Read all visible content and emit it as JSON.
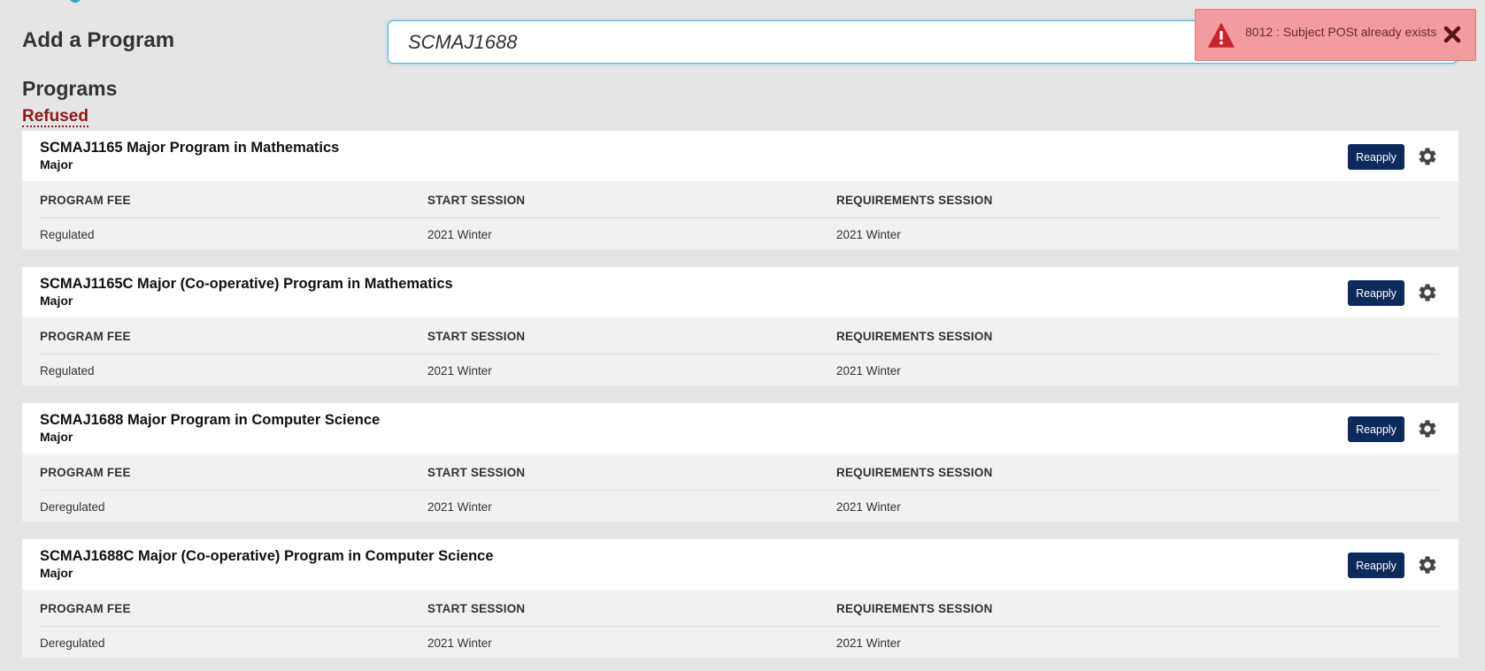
{
  "page": {
    "add_program_title": "Add a Program",
    "search": {
      "value": "SCMAJ1688",
      "placeholder": ""
    },
    "programs_heading": "Programs",
    "status_group": "Refused"
  },
  "toast": {
    "type": "error",
    "message": "8012 : Subject POSt already exists",
    "icons": [
      "warning-icon",
      "close-icon"
    ]
  },
  "columns": {
    "fee": "PROGRAM FEE",
    "start": "START SESSION",
    "requirements": "REQUIREMENTS SESSION"
  },
  "programs": [
    {
      "title": "SCMAJ1165 Major Program in Mathematics",
      "type": "Major",
      "action_label": "Reapply",
      "fee": "Regulated",
      "start_session": "2021 Winter",
      "requirements_session": "2021 Winter"
    },
    {
      "title": "SCMAJ1165C Major (Co-operative) Program in Mathematics",
      "type": "Major",
      "action_label": "Reapply",
      "fee": "Regulated",
      "start_session": "2021 Winter",
      "requirements_session": "2021 Winter"
    },
    {
      "title": "SCMAJ1688 Major Program in Computer Science",
      "type": "Major",
      "action_label": "Reapply",
      "fee": "Deregulated",
      "start_session": "2021 Winter",
      "requirements_session": "2021 Winter"
    },
    {
      "title": "SCMAJ1688C Major (Co-operative) Program in Computer Science",
      "type": "Major",
      "action_label": "Reapply",
      "fee": "Deregulated",
      "start_session": "2021 Winter",
      "requirements_session": "2021 Winter"
    }
  ],
  "colors": {
    "button": "#0c2a5b",
    "refused": "#8b1a1a",
    "toast_bg": "#f29c9f",
    "toast_icon": "#c8262c",
    "input_border": "#54b4e8"
  }
}
